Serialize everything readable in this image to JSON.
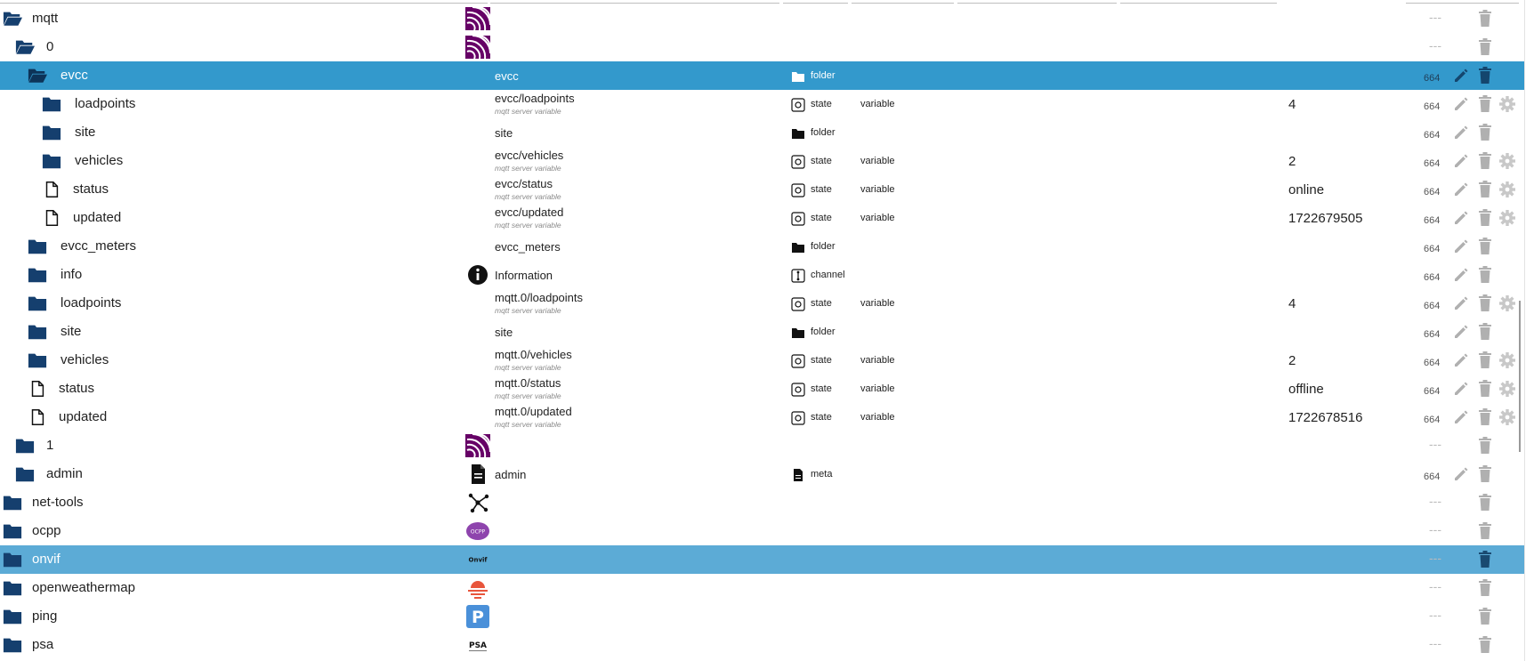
{
  "colors": {
    "accent": "#3399cc",
    "accent_light": "#5cabd6",
    "folder": "#153f6e",
    "icon_grey": "#b0b0b0"
  },
  "rows": [
    {
      "name": "mqtt",
      "indent": 0,
      "folder": "open",
      "adapter_icon": "mqtt-logo-icon",
      "label": "",
      "sub": "",
      "type_icon": "",
      "type": "",
      "role": "",
      "value": "",
      "acl": "",
      "edit": false,
      "cfg": false,
      "sel": ""
    },
    {
      "name": "0",
      "indent": 1,
      "folder": "open",
      "adapter_icon": "mqtt-logo-icon",
      "label": "",
      "sub": "",
      "type_icon": "",
      "type": "",
      "role": "",
      "value": "",
      "acl": "",
      "edit": false,
      "cfg": false,
      "sel": ""
    },
    {
      "name": "evcc",
      "indent": 2,
      "folder": "open",
      "adapter_icon": "",
      "label": "evcc",
      "sub": "",
      "type_icon": "folder",
      "type": "folder",
      "role": "",
      "value": "",
      "acl": "664",
      "edit": true,
      "cfg": false,
      "sel": "sel"
    },
    {
      "name": "loadpoints",
      "indent": 3,
      "folder": "closed",
      "adapter_icon": "",
      "label": "evcc/loadpoints",
      "sub": "mqtt server variable",
      "type_icon": "state",
      "type": "state",
      "role": "variable",
      "value": "4",
      "acl": "664",
      "edit": true,
      "cfg": true,
      "sel": ""
    },
    {
      "name": "site",
      "indent": 3,
      "folder": "closed",
      "adapter_icon": "",
      "label": "site",
      "sub": "",
      "type_icon": "folder",
      "type": "folder",
      "role": "",
      "value": "",
      "acl": "664",
      "edit": true,
      "cfg": false,
      "sel": ""
    },
    {
      "name": "vehicles",
      "indent": 3,
      "folder": "closed",
      "adapter_icon": "",
      "label": "evcc/vehicles",
      "sub": "mqtt server variable",
      "type_icon": "state",
      "type": "state",
      "role": "variable",
      "value": "2",
      "acl": "664",
      "edit": true,
      "cfg": true,
      "sel": ""
    },
    {
      "name": "status",
      "indent": 3,
      "folder": "file",
      "adapter_icon": "",
      "label": "evcc/status",
      "sub": "mqtt server variable",
      "type_icon": "state",
      "type": "state",
      "role": "variable",
      "value": "online",
      "acl": "664",
      "edit": true,
      "cfg": true,
      "sel": ""
    },
    {
      "name": "updated",
      "indent": 3,
      "folder": "file",
      "adapter_icon": "",
      "label": "evcc/updated",
      "sub": "mqtt server variable",
      "type_icon": "state",
      "type": "state",
      "role": "variable",
      "value": "1722679505",
      "acl": "664",
      "edit": true,
      "cfg": true,
      "sel": ""
    },
    {
      "name": "evcc_meters",
      "indent": 2,
      "folder": "closed",
      "adapter_icon": "",
      "label": "evcc_meters",
      "sub": "",
      "type_icon": "folder",
      "type": "folder",
      "role": "",
      "value": "",
      "acl": "664",
      "edit": true,
      "cfg": false,
      "sel": ""
    },
    {
      "name": "info",
      "indent": 2,
      "folder": "closed",
      "adapter_icon": "info-icon",
      "label": "Information",
      "sub": "",
      "type_icon": "channel",
      "type": "channel",
      "role": "",
      "value": "",
      "acl": "664",
      "edit": true,
      "cfg": false,
      "sel": ""
    },
    {
      "name": "loadpoints",
      "indent": 2,
      "folder": "closed",
      "adapter_icon": "",
      "label": "mqtt.0/loadpoints",
      "sub": "mqtt server variable",
      "type_icon": "state",
      "type": "state",
      "role": "variable",
      "value": "4",
      "acl": "664",
      "edit": true,
      "cfg": true,
      "sel": ""
    },
    {
      "name": "site",
      "indent": 2,
      "folder": "closed",
      "adapter_icon": "",
      "label": "site",
      "sub": "",
      "type_icon": "folder",
      "type": "folder",
      "role": "",
      "value": "",
      "acl": "664",
      "edit": true,
      "cfg": false,
      "sel": ""
    },
    {
      "name": "vehicles",
      "indent": 2,
      "folder": "closed",
      "adapter_icon": "",
      "label": "mqtt.0/vehicles",
      "sub": "mqtt server variable",
      "type_icon": "state",
      "type": "state",
      "role": "variable",
      "value": "2",
      "acl": "664",
      "edit": true,
      "cfg": true,
      "sel": ""
    },
    {
      "name": "status",
      "indent": 2,
      "folder": "file",
      "adapter_icon": "",
      "label": "mqtt.0/status",
      "sub": "mqtt server variable",
      "type_icon": "state",
      "type": "state",
      "role": "variable",
      "value": "offline",
      "acl": "664",
      "edit": true,
      "cfg": true,
      "sel": ""
    },
    {
      "name": "updated",
      "indent": 2,
      "folder": "file",
      "adapter_icon": "",
      "label": "mqtt.0/updated",
      "sub": "mqtt server variable",
      "type_icon": "state",
      "type": "state",
      "role": "variable",
      "value": "1722678516",
      "acl": "664",
      "edit": true,
      "cfg": true,
      "sel": ""
    },
    {
      "name": "1",
      "indent": 1,
      "folder": "closed",
      "adapter_icon": "mqtt-logo-icon",
      "label": "",
      "sub": "",
      "type_icon": "",
      "type": "",
      "role": "",
      "value": "",
      "acl": "",
      "edit": false,
      "cfg": false,
      "sel": ""
    },
    {
      "name": "admin",
      "indent": 1,
      "folder": "closed",
      "adapter_icon": "document-icon",
      "label": "admin",
      "sub": "",
      "type_icon": "meta",
      "type": "meta",
      "role": "",
      "value": "",
      "acl": "664",
      "edit": true,
      "cfg": false,
      "sel": ""
    },
    {
      "name": "net-tools",
      "indent": 0,
      "folder": "closed",
      "adapter_icon": "network-icon",
      "label": "",
      "sub": "",
      "type_icon": "",
      "type": "",
      "role": "",
      "value": "",
      "acl": "",
      "edit": false,
      "cfg": false,
      "sel": ""
    },
    {
      "name": "ocpp",
      "indent": 0,
      "folder": "closed",
      "adapter_icon": "ocpp-logo-icon",
      "label": "",
      "sub": "",
      "type_icon": "",
      "type": "",
      "role": "",
      "value": "",
      "acl": "",
      "edit": false,
      "cfg": false,
      "sel": ""
    },
    {
      "name": "onvif",
      "indent": 0,
      "folder": "closed",
      "adapter_icon": "onvif-logo-icon",
      "label": "",
      "sub": "",
      "type_icon": "",
      "type": "",
      "role": "",
      "value": "",
      "acl": "",
      "edit": false,
      "cfg": false,
      "sel": "sel2"
    },
    {
      "name": "openweathermap",
      "indent": 0,
      "folder": "closed",
      "adapter_icon": "sunset-icon",
      "label": "",
      "sub": "",
      "type_icon": "",
      "type": "",
      "role": "",
      "value": "",
      "acl": "",
      "edit": false,
      "cfg": false,
      "sel": ""
    },
    {
      "name": "ping",
      "indent": 0,
      "folder": "closed",
      "adapter_icon": "parking-p-icon",
      "label": "",
      "sub": "",
      "type_icon": "",
      "type": "",
      "role": "",
      "value": "",
      "acl": "",
      "edit": false,
      "cfg": false,
      "sel": ""
    },
    {
      "name": "psa",
      "indent": 0,
      "folder": "closed",
      "adapter_icon": "psa-logo-icon",
      "label": "",
      "sub": "",
      "type_icon": "",
      "type": "",
      "role": "",
      "value": "",
      "acl": "",
      "edit": false,
      "cfg": false,
      "sel": ""
    }
  ],
  "logo_text": {
    "onvif": "Onvif",
    "psa": "PSA",
    "ping": "P",
    "ocpp": "OCPP"
  },
  "no_acl": "---"
}
